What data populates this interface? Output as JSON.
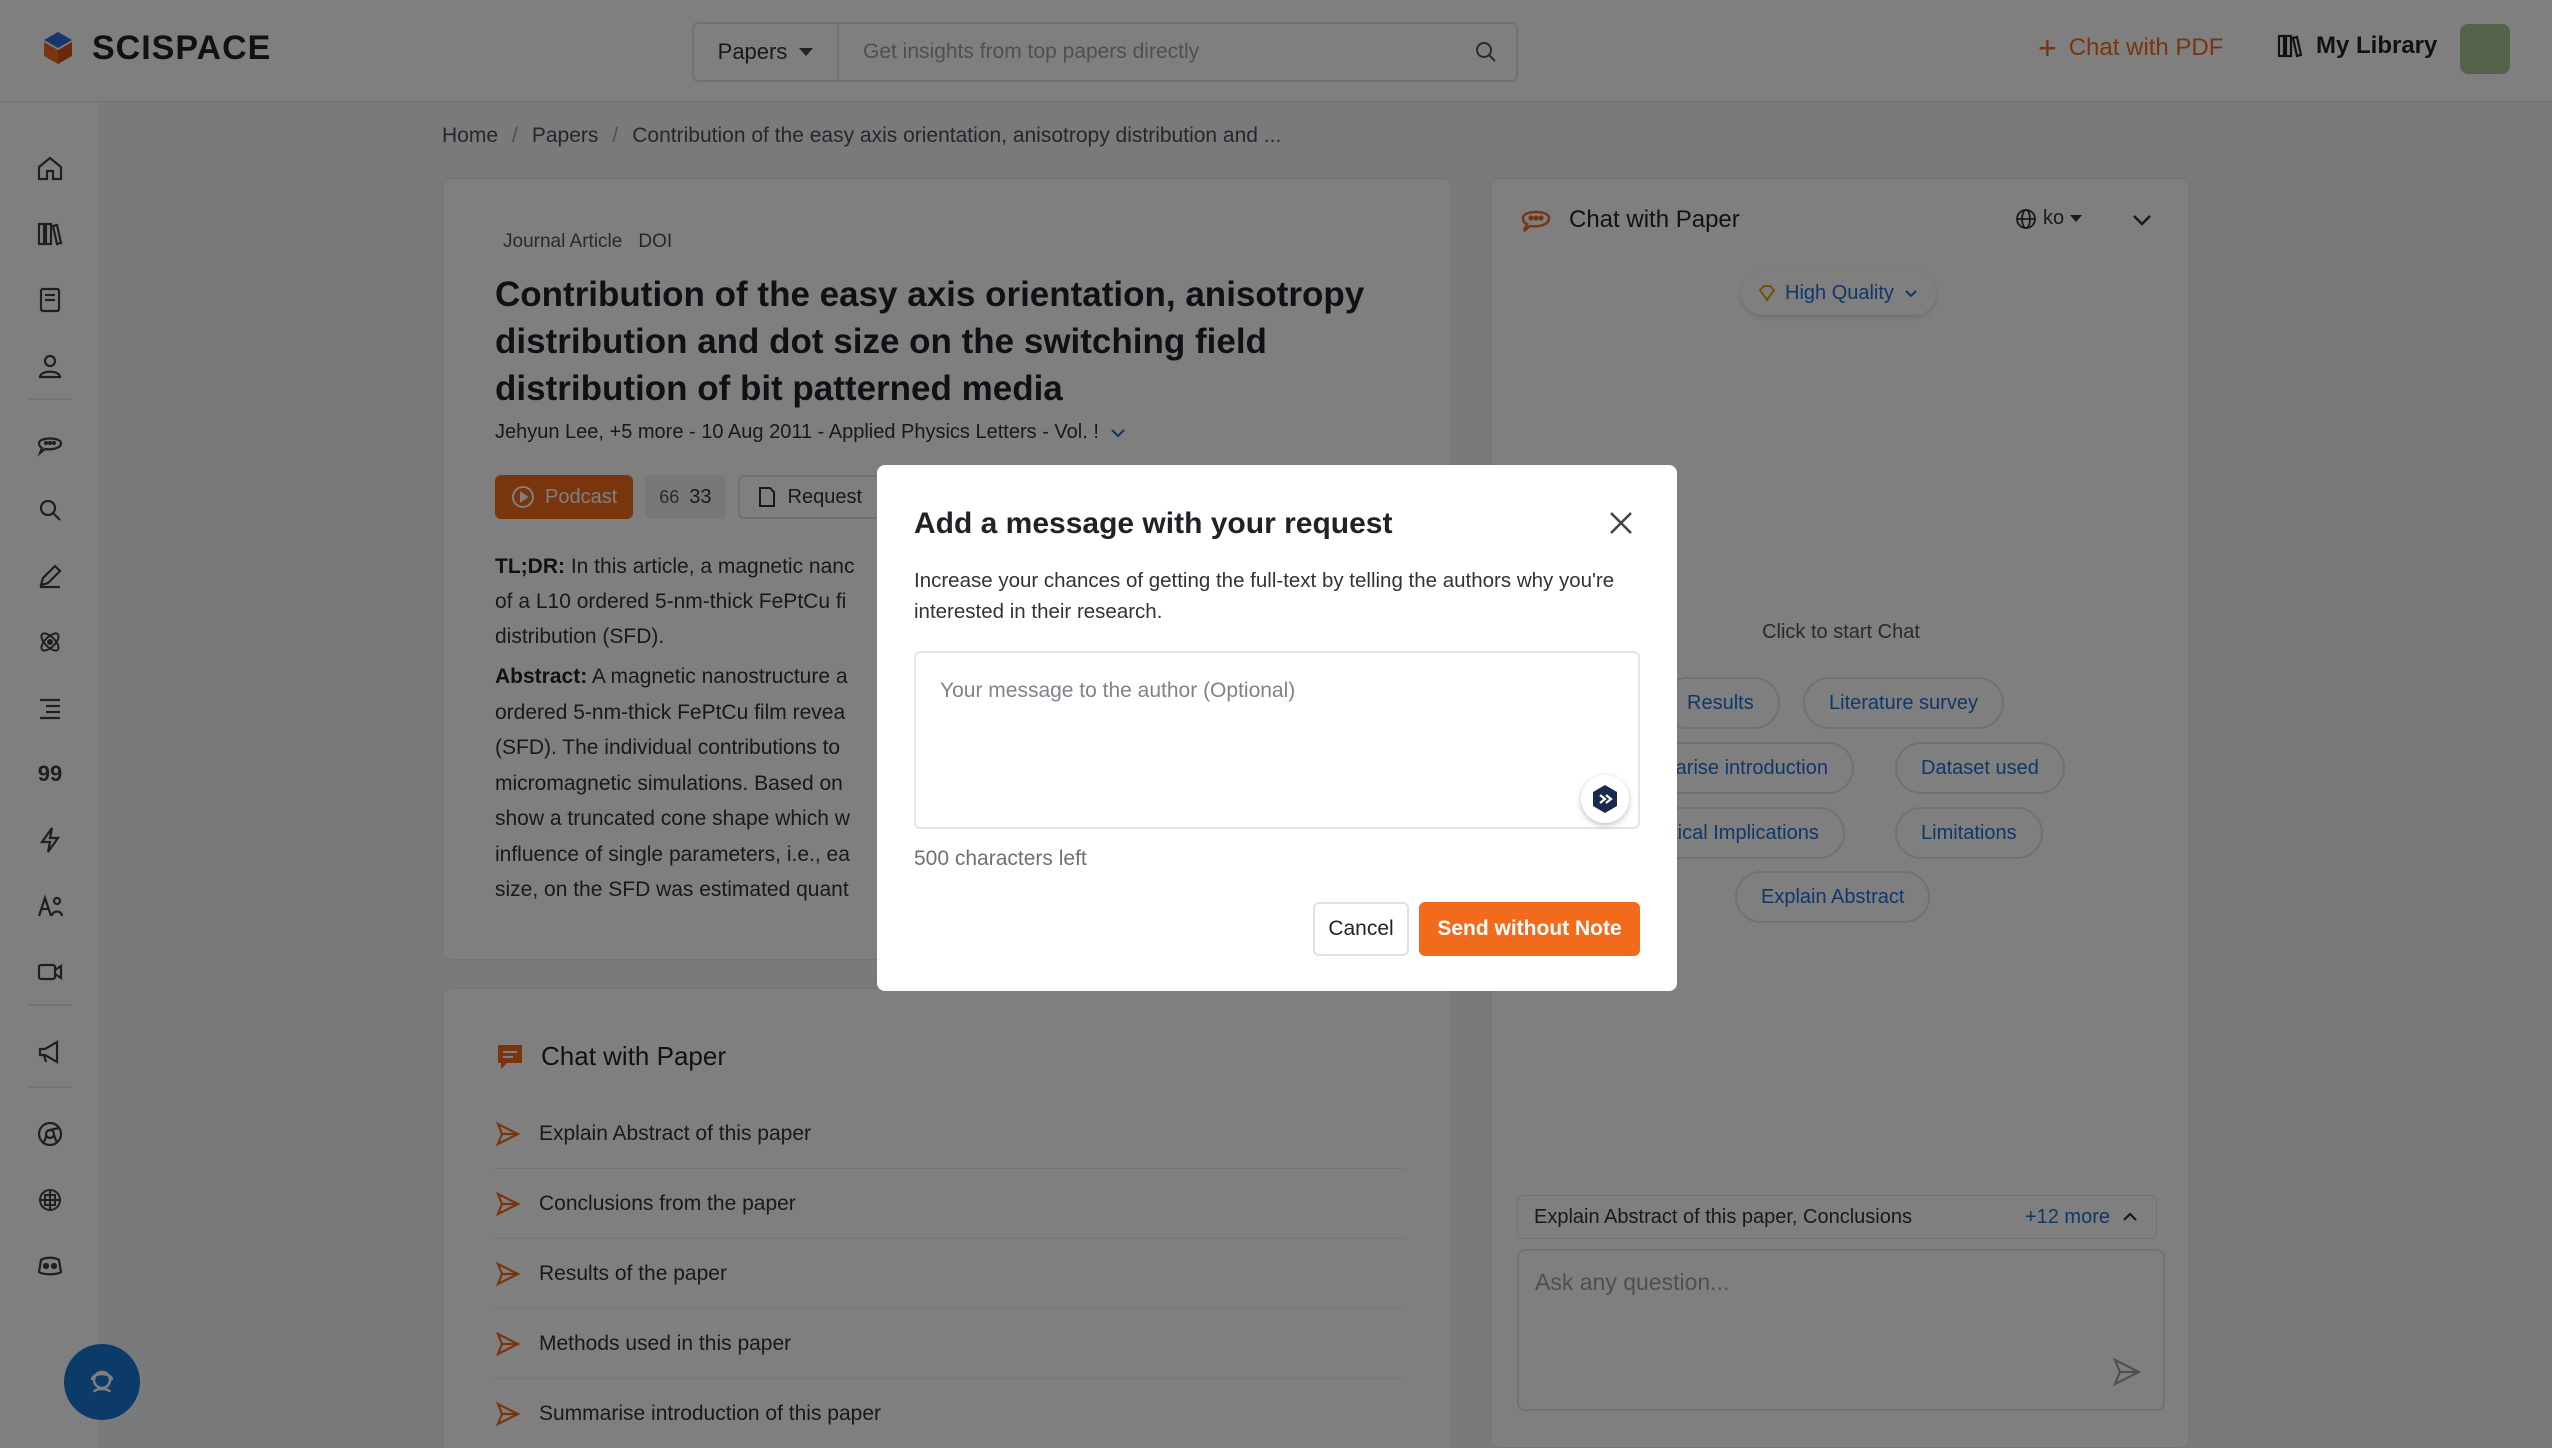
{
  "app": {
    "name": "SCISPACE"
  },
  "header": {
    "search_type": "Papers",
    "search_placeholder": "Get insights from top papers directly",
    "chat_pdf_label": "Chat with PDF",
    "my_library_label": "My Library"
  },
  "sidebar": {
    "items": [
      {
        "icon": "home-icon"
      },
      {
        "icon": "library-icon"
      },
      {
        "icon": "notebook-icon"
      },
      {
        "icon": "user-icon"
      },
      {
        "icon": "chat-icon"
      },
      {
        "icon": "literature-search-icon"
      },
      {
        "icon": "pen-icon"
      },
      {
        "icon": "atom-icon"
      },
      {
        "icon": "outline-icon"
      },
      {
        "icon": "citation-icon",
        "text": "99"
      },
      {
        "icon": "bolt-icon"
      },
      {
        "icon": "ai-detector-icon"
      },
      {
        "icon": "video-icon"
      },
      {
        "icon": "megaphone-icon"
      },
      {
        "icon": "chrome-icon"
      },
      {
        "icon": "openai-icon"
      },
      {
        "icon": "discord-icon"
      }
    ]
  },
  "breadcrumb": [
    "Home",
    "Papers",
    "Contribution of the easy axis orientation, anisotropy distribution and ..."
  ],
  "paper": {
    "type": "Journal Article",
    "doi_label": "DOI",
    "title": "Contribution of the easy axis orientation, anisotropy distribution and dot size on the switching field distribution of bit patterned media",
    "authors": "Jehyun Lee,  +5 more - 10 Aug 2011 - Applied Physics Letters  - Vol. !",
    "podcast_label": "Podcast",
    "citations": "33",
    "request_label": "Request",
    "tldr_label": "TL;DR:",
    "tldr_lines": [
      "In this article, a magnetic nanc",
      "of a L10 ordered 5-nm-thick FePtCu fi",
      "distribution (SFD)."
    ],
    "abstract_label": "Abstract:",
    "abstract_lines": [
      "A magnetic nanostructure a",
      "ordered 5-nm-thick FePtCu film revea",
      "(SFD). The individual contributions to",
      "micromagnetic simulations. Based on",
      "show a truncated cone shape which w",
      "influence of single parameters, i.e., ea",
      "size, on the SFD was estimated quant"
    ]
  },
  "chat_card": {
    "title": "Chat with Paper",
    "questions": [
      "Explain Abstract of this paper",
      "Conclusions from the paper",
      "Results of the paper",
      "Methods used in this paper",
      "Summarise introduction of this paper"
    ]
  },
  "side_chat": {
    "title": "Chat with Paper",
    "language": "ko",
    "quality": "High Quality",
    "click_to_start": "Click to start Chat",
    "chips": [
      "Results",
      "Literature survey",
      "marise introduction",
      "Dataset used",
      "actical Implications",
      "Limitations",
      "Explain Abstract"
    ],
    "suggest_text": "Explain Abstract of this paper, Conclusions",
    "suggest_more": "+12 more",
    "ask_placeholder": "Ask any question..."
  },
  "modal": {
    "title": "Add a message with your request",
    "description": "Increase your chances of getting the full-text by telling the authors why you're interested in their research.",
    "message_placeholder": "Your message to the author (Optional)",
    "chars_left": "500 characters left",
    "cancel_label": "Cancel",
    "send_label": "Send without Note"
  },
  "colors": {
    "accent": "#f26a1b",
    "link": "#1e6fd0",
    "fab": "#1877d2"
  }
}
